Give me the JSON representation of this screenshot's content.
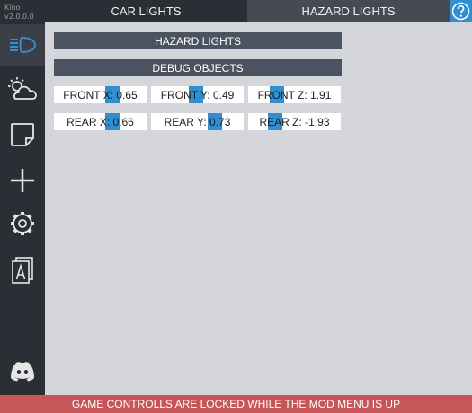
{
  "app": {
    "name": "Kino",
    "version": "v2.0.0.0"
  },
  "sidebar": {
    "items": [
      {
        "icon": "headlight-icon",
        "active": true
      },
      {
        "icon": "weather-icon"
      },
      {
        "icon": "note-icon"
      },
      {
        "icon": "plus-icon"
      },
      {
        "icon": "gear-icon"
      },
      {
        "icon": "font-icon"
      },
      {
        "icon": "discord-icon"
      }
    ]
  },
  "tabs": {
    "car_lights": "CAR LIGHTS",
    "hazard_lights": "HAZARD LIGHTS",
    "active": "hazard_lights",
    "help_icon": "help-icon"
  },
  "main": {
    "hazard_header": "HAZARD LIGHTS",
    "debug_header": "DEBUG OBJECTS",
    "sliders": {
      "front_x": "FRONT X: 0.65",
      "front_y": "FRONT Y: 0.49",
      "front_z": "FRONT Z: 1.91",
      "rear_x": "REAR X: 0.66",
      "rear_y": "REAR Y: 0.73",
      "rear_z": "REAR Z: -1.93"
    }
  },
  "banner": "GAME CONTROLLS ARE LOCKED WHILE THE MOD MENU IS UP",
  "colors": {
    "accent": "#2f8fd0",
    "sidebar": "#2b2e35",
    "header": "#4b5260",
    "background": "#d4d6dc",
    "banner": "#c65658"
  }
}
